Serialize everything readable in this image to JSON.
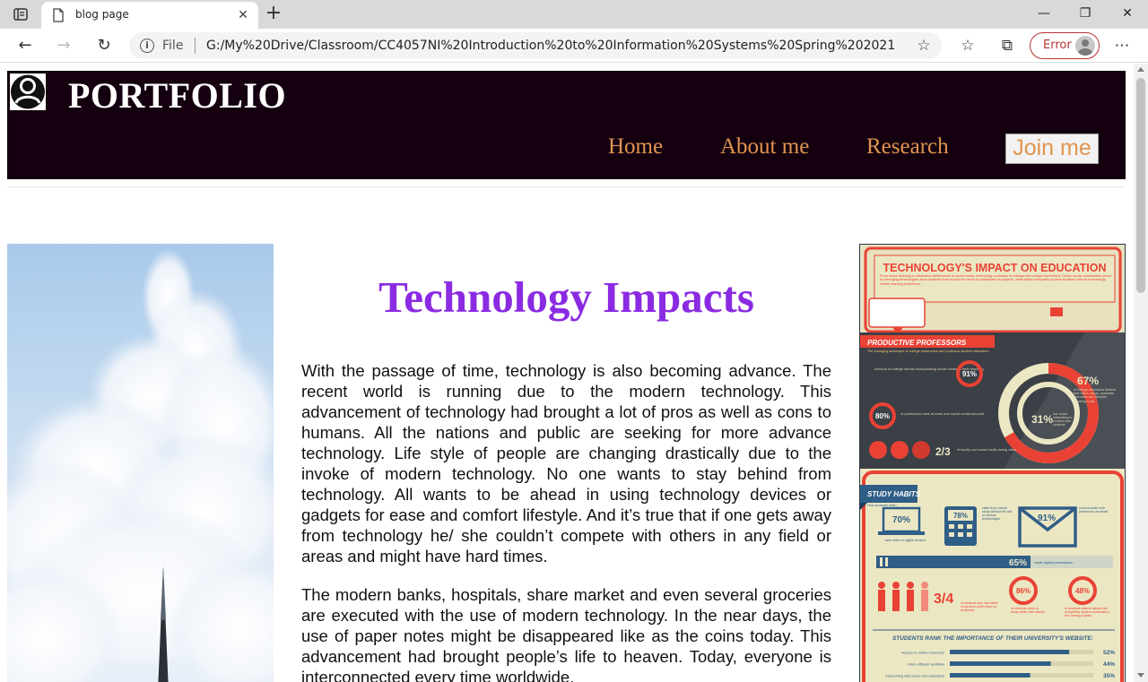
{
  "browser": {
    "tab_title": "blog page",
    "omnibox_scheme": "File",
    "url": "G:/My%20Drive/Classroom/CC4057NI%20Introduction%20to%20Information%20Systems%20Spring%202021",
    "profile_label": "Error"
  },
  "site": {
    "title": "PORTFOLIO",
    "nav": {
      "home": "Home",
      "about": "About me",
      "research": "Research",
      "join": "Join me"
    }
  },
  "article": {
    "title": "Technology Impacts",
    "paragraphs": [
      "With the passage of time, technology is also becoming advance. The recent world is running due to the modern technology. This advancement of technology had brought a lot of pros as well as cons to humans. All the nations and public are seeking for more advance technology. Life style of people are changing drastically due to the invoke of modern technology. No one wants to stay behind from technology. All wants to be ahead in using technology devices or gadgets for ease and comfort lifestyle. And it’s true that if one gets away from technology he/ she couldn’t compete with others in any field or areas and might have hard times.",
      "The modern banks, hospitals, share market and even several groceries are executed with the use of modern technology. In the near days, the use of paper notes might be disappeared like as the coins today. This advancement had brought people’s life to heaven. Today, everyone is interconnected every time worldwide."
    ]
  },
  "infographic": {
    "title": "TECHNOLOGY'S IMPACT ON EDUCATION",
    "intro": "From online learning to interactive whiteboards to social media, technology continues to reshape the college experience. Online social communities driven by emerging technologies allow students from across the world to collaborate on projects, while tablet computers provide students with an increasingly mobile learning experience.",
    "professors_heading": "PRODUCTIVE PROFESSORS",
    "professors_sub": "The changing landscape of college classrooms and professor-student interaction",
    "pct_91": "91%",
    "pct_91_text": "Amount of college faculty incorporating social media in their teaching",
    "pct_80": "80%",
    "pct_80_text": "of professors have at least one social media account",
    "pct_67": "67%",
    "pct_67_text": "of college educators believe that video, blogs, podcasts and wikis are valuable teaching tools",
    "pct_31": "31%",
    "pct_31_text": "use social networking to connect with students",
    "frac_2_3": "2/3",
    "frac_2_3_text": "of faculty use social media during class",
    "study_heading": "STUDY HABITS",
    "study_sub": "How students learn",
    "pct_70": "70%",
    "pct_70_text": "take notes on digital devices",
    "pct_78": "78%",
    "pct_78_text": "claim they cannot study without the aid of various technologies",
    "pct_91b": "91%",
    "pct_91b_text": "communicate with professors via email",
    "pct_65": "65%",
    "pct_65_text": "create digital presentations",
    "frac_3_4": "3/4",
    "frac_3_4_text": "of students who use tablet computers prefer them to textbooks",
    "pct_86": "86%",
    "pct_86_text": "of students claim to study better with tablets",
    "pct_48": "48%",
    "pct_48_text": "of students believe tablets will completely replace textbooks in the coming 5 years",
    "website_heading": "STUDENTS RANK THE IMPORTANCE OF THEIR UNIVERSITY'S WEBSITE:",
    "bars": [
      {
        "label": "Access to online resources",
        "value": "52%",
        "fraction": 0.52
      },
      {
        "label": "More efficient workflow",
        "value": "44%",
        "fraction": 0.44
      },
      {
        "label": "Connecting with peers and educators",
        "value": "35%",
        "fraction": 0.35
      }
    ]
  },
  "colors": {
    "header_bg": "#14000f",
    "nav_link": "#e0954f",
    "article_title": "#8a2be2",
    "info_red": "#e94235",
    "info_cream": "#ece7c3",
    "info_dark": "#3b3f46",
    "info_blue": "#2f5e87"
  }
}
